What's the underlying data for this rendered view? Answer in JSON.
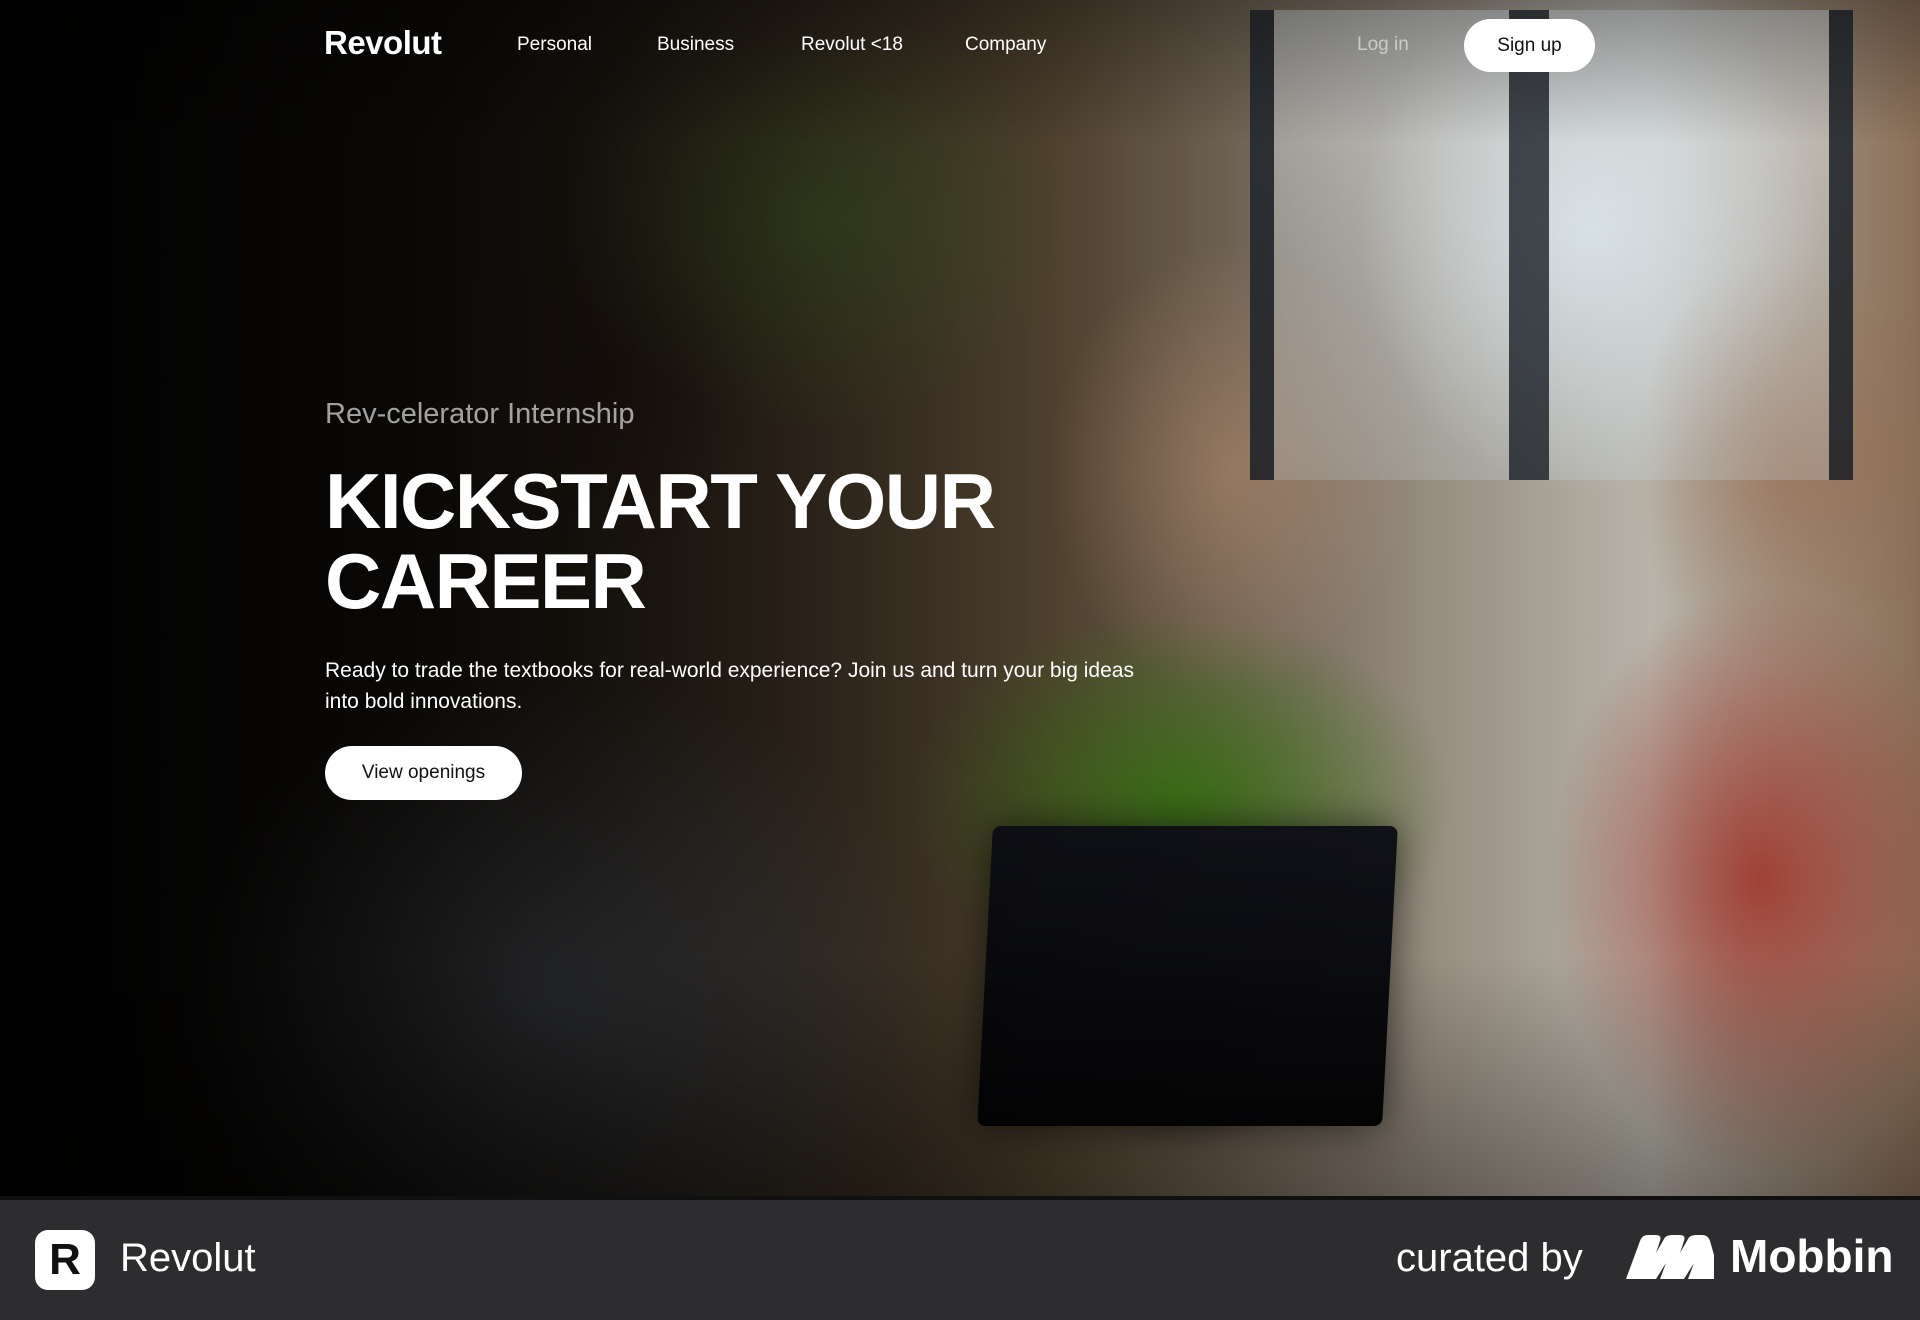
{
  "nav": {
    "logo": "Revolut",
    "links": [
      "Personal",
      "Business",
      "Revolut <18",
      "Company"
    ],
    "login": "Log in",
    "signup": "Sign up"
  },
  "hero": {
    "eyebrow": "Rev-celerator Internship",
    "headline": "KICKSTART YOUR CAREER",
    "subtext": "Ready to trade the textbooks for real-world experience? Join us and turn your big ideas into bold innovations.",
    "cta": "View openings"
  },
  "brand_bar": {
    "app_icon_letter": "R",
    "app_name": "Revolut",
    "curated_by": "curated by",
    "mobbin": "Mobbin"
  },
  "colors": {
    "footer_bg": "#2d2d2f",
    "button_bg": "#ffffff",
    "text": "#ffffff"
  }
}
